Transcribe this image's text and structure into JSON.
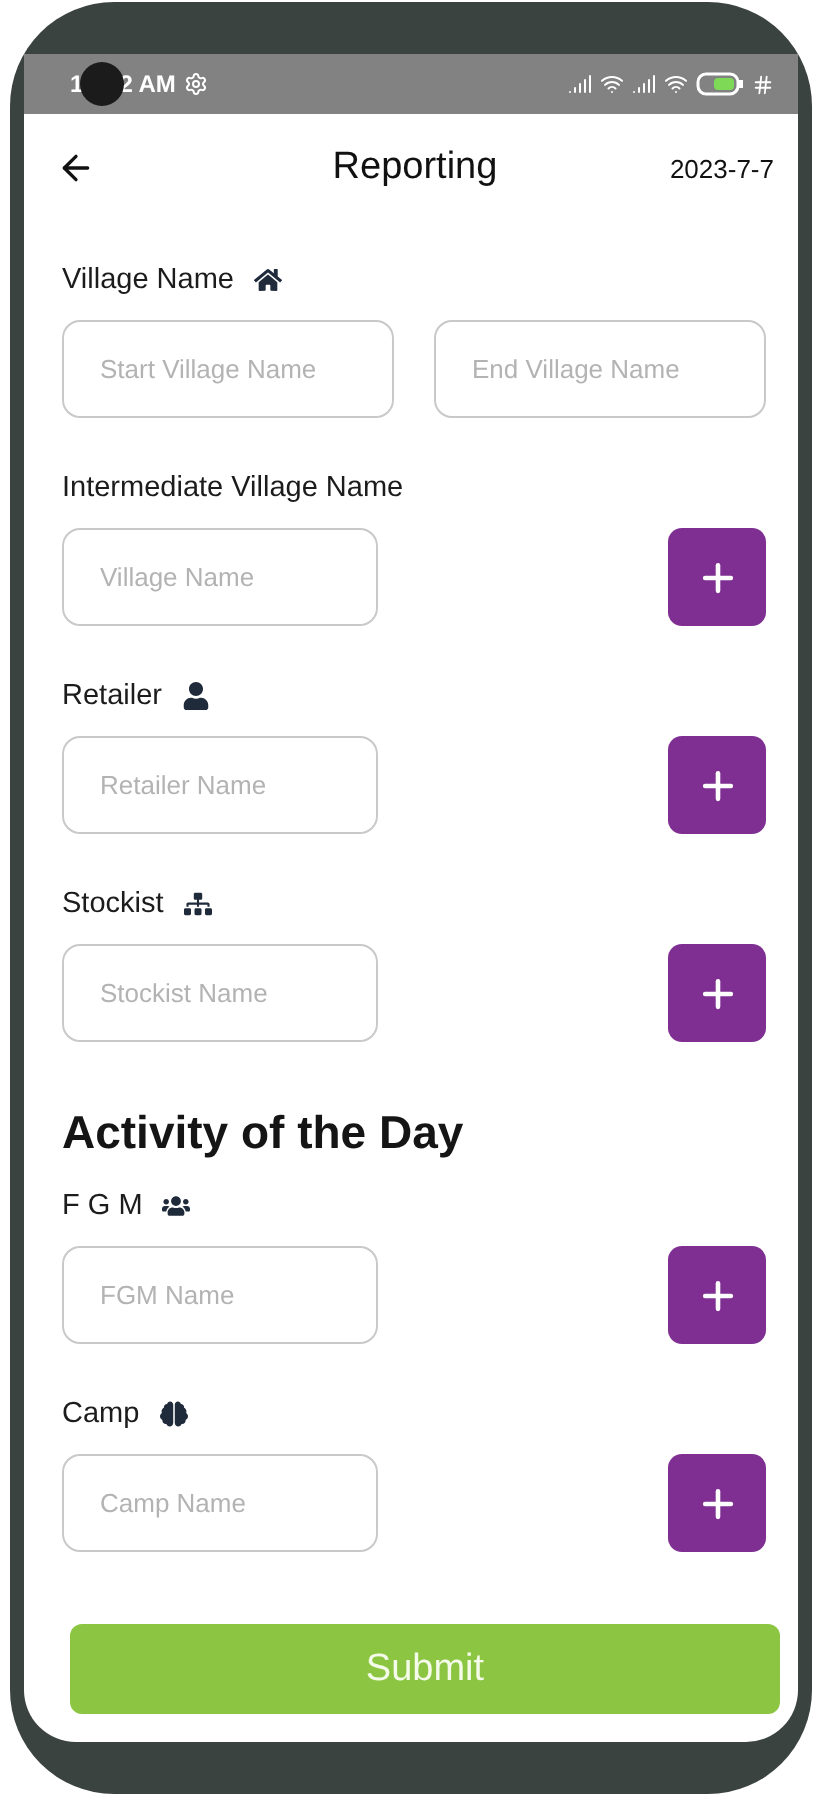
{
  "status_bar": {
    "time_before_camera": "1",
    "time_after_camera": "2 AM"
  },
  "header": {
    "title": "Reporting",
    "date": "2023-7-7"
  },
  "items": [
    {
      "kind": "group",
      "label": "Village Name",
      "placeholders": [
        "Start Village Name",
        "End Village Name"
      ],
      "add": false
    },
    {
      "kind": "group",
      "label": "Intermediate Village Name",
      "placeholders": [
        "Village Name"
      ],
      "add": true
    },
    {
      "kind": "group",
      "label": "Retailer",
      "placeholders": [
        "Retailer Name"
      ],
      "add": true
    },
    {
      "kind": "group",
      "label": "Stockist",
      "placeholders": [
        "Stockist Name"
      ],
      "add": true
    },
    {
      "kind": "heading",
      "label": "Activity of the Day"
    },
    {
      "kind": "group",
      "label": "F G M",
      "placeholders": [
        "FGM Name"
      ],
      "add": true
    },
    {
      "kind": "group",
      "label": "Camp",
      "placeholders": [
        "Camp Name"
      ],
      "add": true
    }
  ],
  "submit": "Submit"
}
